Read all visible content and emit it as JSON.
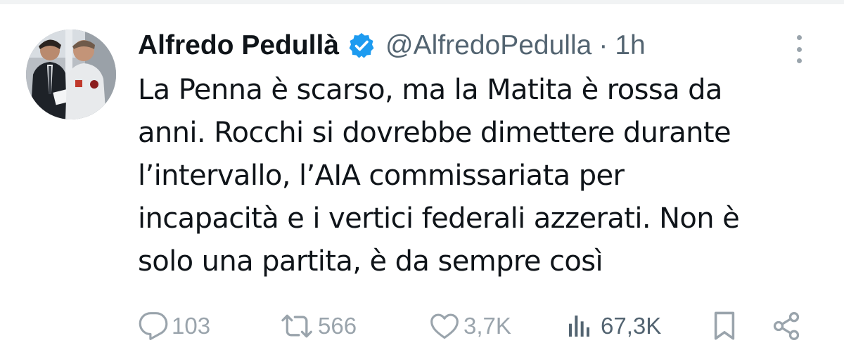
{
  "tweet": {
    "author": {
      "display_name": "Alfredo Pedullà",
      "handle": "@AlfredoPedulla",
      "verified": true,
      "verified_color": "#1d9bf0"
    },
    "separator": "·",
    "time": "1h",
    "text_lines": [
      "La Penna è scarso, ma la Matita è rossa da",
      "anni. Rocchi si dovrebbe dimettere durante",
      "l’intervallo, l’AIA commissariata per",
      "incapacità e i vertici federali azzerati. Non è",
      "solo una partita, è da sempre così"
    ]
  },
  "actions": {
    "reply": {
      "icon": "reply-icon",
      "count": "103"
    },
    "retweet": {
      "icon": "retweet-icon",
      "count": "566"
    },
    "like": {
      "icon": "heart-icon",
      "count": "3,7K"
    },
    "views": {
      "icon": "views-icon",
      "count": "67,3K"
    },
    "bookmark": {
      "icon": "bookmark-icon"
    },
    "share": {
      "icon": "share-icon"
    }
  },
  "colors": {
    "text_primary": "#0f1419",
    "text_secondary": "#536471",
    "icon_muted": "#9aa4ac"
  }
}
